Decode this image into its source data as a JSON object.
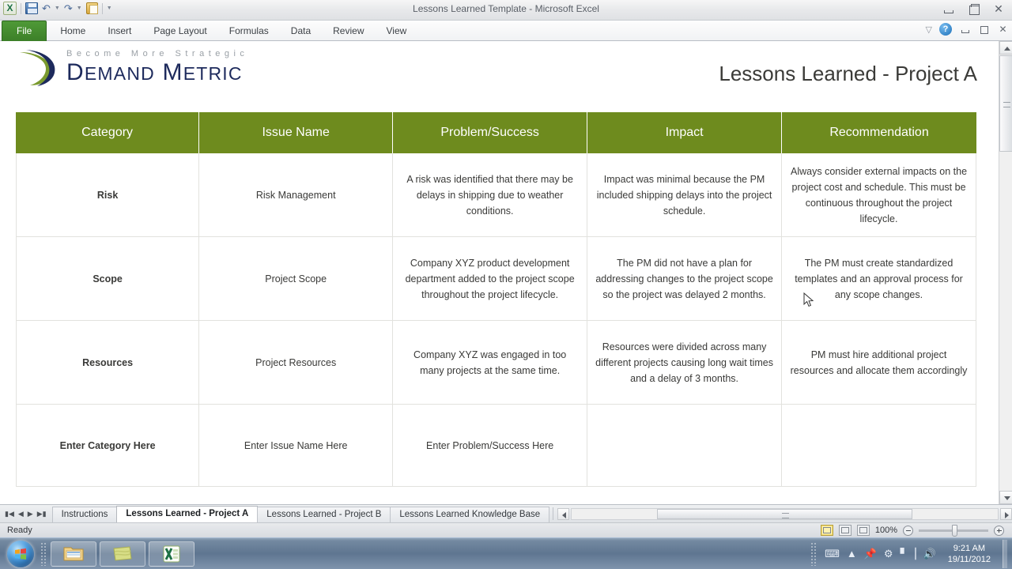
{
  "window": {
    "title": "Lessons Learned Template  -  Microsoft Excel",
    "quick_access": [
      "save-icon",
      "undo-icon",
      "redo-icon",
      "clipboard-icon",
      "customize-icon"
    ],
    "controls": {
      "minimize": "minimize",
      "restore": "restore",
      "close": "close"
    }
  },
  "ribbon": {
    "tabs": [
      {
        "label": "File",
        "active": true
      },
      {
        "label": "Home",
        "active": false
      },
      {
        "label": "Insert",
        "active": false
      },
      {
        "label": "Page Layout",
        "active": false
      },
      {
        "label": "Formulas",
        "active": false
      },
      {
        "label": "Data",
        "active": false
      },
      {
        "label": "Review",
        "active": false
      },
      {
        "label": "View",
        "active": false
      }
    ]
  },
  "branding": {
    "tagline": "Become More Strategic",
    "name_first": "D",
    "name_first_rest": "EMAND",
    "name_second": "M",
    "name_second_rest": "ETRIC"
  },
  "document": {
    "heading": "Lessons Learned - Project A"
  },
  "table": {
    "header_color": "#6e8b1e",
    "columns": [
      "Category",
      "Issue Name",
      "Problem/Success",
      "Impact",
      "Recommendation"
    ],
    "rows": [
      {
        "category": "Risk",
        "issue": "Risk Management",
        "problem": "A risk was identified that there may be delays in shipping due to weather conditions.",
        "impact": "Impact was minimal because the PM included shipping delays into the project schedule.",
        "recommendation": "Always consider external impacts on the project cost and schedule. This must be continuous throughout the project lifecycle."
      },
      {
        "category": "Scope",
        "issue": "Project Scope",
        "problem": "Company XYZ product development department added to the project scope throughout the project lifecycle.",
        "impact": "The PM did not have a plan for addressing changes to the project scope so the project was delayed 2 months.",
        "recommendation": "The PM must create standardized templates and an approval process for any scope changes."
      },
      {
        "category": "Resources",
        "issue": "Project Resources",
        "problem": "Company XYZ was engaged in too many projects at the same time.",
        "impact": "Resources were divided across many different projects causing long wait times and a delay of 3 months.",
        "recommendation": "PM must hire additional project resources and allocate them accordingly"
      },
      {
        "category": "Enter Category Here",
        "issue": "Enter Issue Name Here",
        "problem": "Enter Problem/Success Here",
        "impact": "",
        "recommendation": ""
      }
    ]
  },
  "sheet_tabs": {
    "nav": [
      "first-sheet",
      "prev-sheet",
      "next-sheet",
      "last-sheet"
    ],
    "items": [
      {
        "label": "Instructions",
        "active": false
      },
      {
        "label": "Lessons Learned - Project A",
        "active": true
      },
      {
        "label": "Lessons Learned - Project B",
        "active": false
      },
      {
        "label": "Lessons Learned Knowledge Base",
        "active": false
      }
    ]
  },
  "status_bar": {
    "state": "Ready",
    "view_buttons": [
      "normal-view",
      "page-layout-view",
      "page-break-view"
    ],
    "zoom_level": "100%"
  },
  "taskbar": {
    "start": "start-orb",
    "items": [
      "file-explorer",
      "sticky-notes",
      "excel"
    ],
    "tray": [
      "keyboard-icon",
      "show-hidden-icon",
      "pin-icon",
      "action-icon",
      "network-icon",
      "volume-icon"
    ],
    "time": "9:21 AM",
    "date": "19/11/2012"
  }
}
